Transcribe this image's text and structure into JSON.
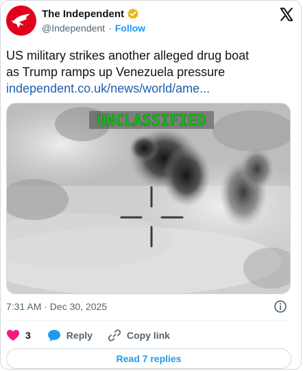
{
  "author": {
    "name": "The Independent",
    "handle": "@Independent",
    "follow_label": "Follow",
    "verified_badge_color": "#e2b719",
    "avatar_color": "#e3001b"
  },
  "tweet": {
    "text_line1": "US military strikes another alleged drug boat",
    "text_line2": "as Trump ramps up Venezuela pressure",
    "link": "independent.co.uk/news/world/ame..."
  },
  "media": {
    "overlay_label": "UNCLASSIFIED",
    "overlay_color": "#19c219",
    "icon": "crosshair-icon"
  },
  "meta": {
    "timestamp": "7:31 AM · Dec 30, 2025"
  },
  "actions": {
    "likes_count": "3",
    "reply_label": "Reply",
    "copy_link_label": "Copy link"
  },
  "footer": {
    "read_replies_label": "Read 7 replies"
  }
}
